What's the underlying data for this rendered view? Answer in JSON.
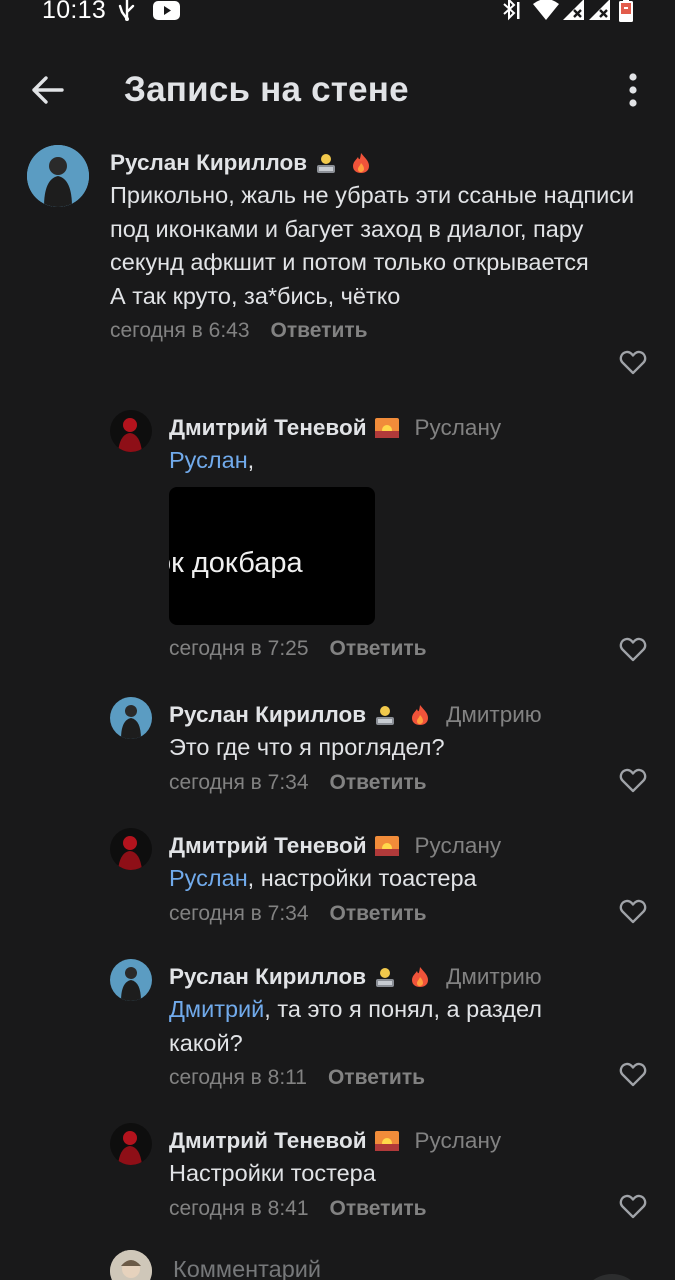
{
  "status_bar": {
    "time": "10:13",
    "left_icons": [
      "usb-icon",
      "youtube-icon"
    ],
    "right_icons": [
      "bluetooth-icon",
      "wifi-icon",
      "signal-icon",
      "signal-icon",
      "battery-icon"
    ]
  },
  "header": {
    "title": "Запись на стене",
    "back_icon": "arrow-left-icon",
    "more_icon": "more-vertical-icon"
  },
  "comments": [
    {
      "author": "Руслан Кириллов",
      "emojis": [
        "technologist-emoji",
        "fire-emoji"
      ],
      "reply_to": "",
      "mention": "",
      "text": "Прикольно, жаль не убрать эти ссаные надписи под иконками и багует заход в диалог, пару секунд афкшит и потом только открывается\nА так круто, за*бись, чётко",
      "time": "сегодня в 6:43",
      "reply_label": "Ответить"
    },
    {
      "author": "Дмитрий Теневой",
      "emojis": [
        "sunset-emoji"
      ],
      "reply_to": "Руслану",
      "mention": "Руслан",
      "text": ",",
      "attachment_text": "ок докбара",
      "time": "сегодня в 7:25",
      "reply_label": "Ответить"
    },
    {
      "author": "Руслан Кириллов",
      "emojis": [
        "technologist-emoji",
        "fire-emoji"
      ],
      "reply_to": "Дмитрию",
      "mention": "",
      "text": "Это где что я проглядел?",
      "time": "сегодня в 7:34",
      "reply_label": "Ответить"
    },
    {
      "author": "Дмитрий Теневой",
      "emojis": [
        "sunset-emoji"
      ],
      "reply_to": "Руслану",
      "mention": "Руслан",
      "text": ", настройки тоастера",
      "time": "сегодня в 7:34",
      "reply_label": "Ответить"
    },
    {
      "author": "Руслан Кириллов",
      "emojis": [
        "technologist-emoji",
        "fire-emoji"
      ],
      "reply_to": "Дмитрию",
      "mention": "Дмитрий",
      "text": ", та это я понял, а раздел какой?",
      "time": "сегодня в 8:11",
      "reply_label": "Ответить"
    },
    {
      "author": "Дмитрий Теневой",
      "emojis": [
        "sunset-emoji"
      ],
      "reply_to": "Руслану",
      "mention": "",
      "text": "Настройки тостера",
      "time": "сегодня в 8:41",
      "reply_label": "Ответить"
    }
  ],
  "composer": {
    "placeholder": "Комментарий"
  },
  "colors": {
    "background": "#19191a",
    "text_primary": "#e1e3e6",
    "text_secondary": "#828282",
    "link": "#71aaeb"
  }
}
